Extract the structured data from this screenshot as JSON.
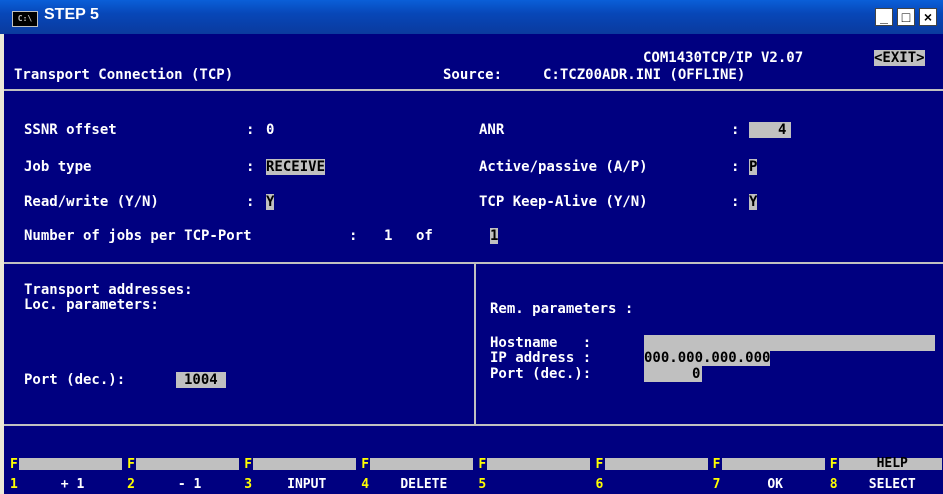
{
  "window": {
    "title": "STEP 5",
    "sys_icon": "C:\\",
    "min": "_",
    "max": "□",
    "close": "×"
  },
  "header": {
    "product": "COM1430TCP/IP V2.07",
    "exit": "<EXIT>",
    "screen_title": "Transport Connection (TCP)",
    "source_label": "Source:",
    "source_value": "C:TCZ00ADR.INI (OFFLINE)"
  },
  "params": {
    "ssnr_label": "SSNR offset",
    "ssnr_value": "0",
    "anr_label": "ANR",
    "anr_value": "4",
    "job_type_label": "Job type",
    "job_type_value": "RECEIVE",
    "active_label": "Active/passive (A/P)",
    "active_value": "P",
    "rw_label": "Read/write (Y/N)",
    "rw_value": "Y",
    "keepalive_label": "TCP Keep-Alive (Y/N)",
    "keepalive_value": "Y",
    "jobs_label": "Number of jobs per TCP-Port",
    "jobs_current": "1",
    "jobs_of": "of",
    "jobs_total": "1",
    "colon": ":"
  },
  "transport": {
    "title": "Transport addresses:",
    "loc_label": "Loc. parameters:",
    "loc_port_label": "Port (dec.):",
    "loc_port_value": "1004",
    "rem_label": "Rem. parameters :",
    "hostname_label": "Hostname   :",
    "hostname_value": "",
    "ip_label": "IP address :",
    "ip_value": "000.000.000.000",
    "rem_port_label": "Port (dec.):",
    "rem_port_value": "0"
  },
  "fkeys": [
    {
      "num": "1",
      "label": "+ 1"
    },
    {
      "num": "2",
      "label": "- 1"
    },
    {
      "num": "3",
      "label": "INPUT"
    },
    {
      "num": "4",
      "label": "DELETE"
    },
    {
      "num": "5",
      "label": ""
    },
    {
      "num": "6",
      "label": ""
    },
    {
      "num": "7",
      "label": "OK"
    },
    {
      "num": "8",
      "label": "SELECT",
      "top_label": "HELP"
    }
  ],
  "fkey_letter": "F",
  "colors": {
    "background": "#000080",
    "text": "#ffffff",
    "field": "#c0c0c0",
    "fkey_number": "#ffff00",
    "titlebar": "#0747b8"
  }
}
